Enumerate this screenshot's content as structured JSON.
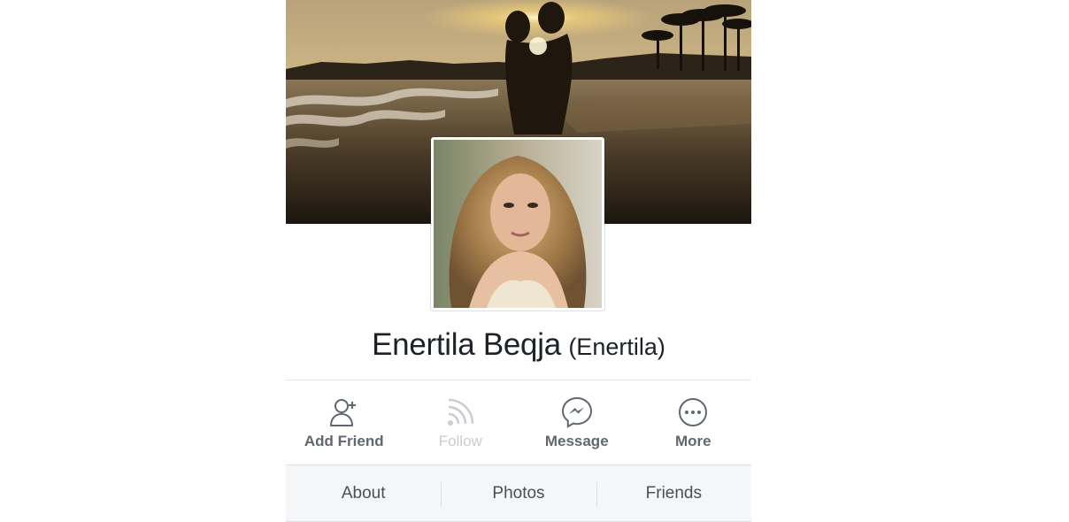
{
  "profile": {
    "name": "Enertila Beqja",
    "alternate_name": "(Enertila)"
  },
  "actions": [
    {
      "label": "Add Friend",
      "icon": "add-friend-icon",
      "enabled": true
    },
    {
      "label": "Follow",
      "icon": "follow-rss-icon",
      "enabled": false
    },
    {
      "label": "Message",
      "icon": "messenger-icon",
      "enabled": true
    },
    {
      "label": "More",
      "icon": "more-dots-icon",
      "enabled": true
    }
  ],
  "tabs": [
    {
      "label": "About"
    },
    {
      "label": "Photos"
    },
    {
      "label": "Friends"
    }
  ],
  "colors": {
    "icon": "#616770",
    "icon_disabled": "#c9ccd1",
    "tab_bar_bg": "#f5f6f7",
    "name_text": "#1d2129"
  }
}
